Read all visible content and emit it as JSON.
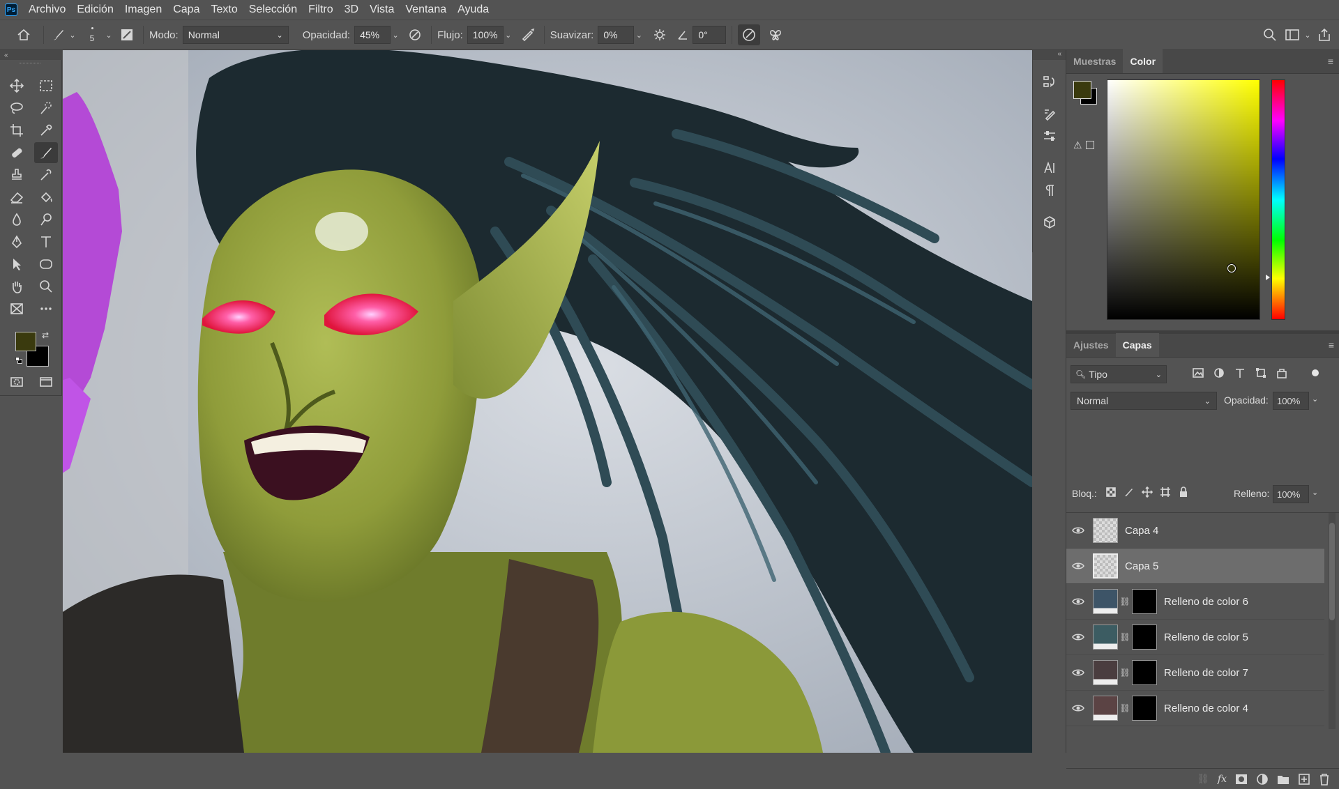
{
  "app": {
    "logo": "Ps"
  },
  "menu": [
    "Archivo",
    "Edición",
    "Imagen",
    "Capa",
    "Texto",
    "Selección",
    "Filtro",
    "3D",
    "Vista",
    "Ventana",
    "Ayuda"
  ],
  "options": {
    "brush_size": "5",
    "mode_label": "Modo:",
    "mode_value": "Normal",
    "opacity_label": "Opacidad:",
    "opacity_value": "45%",
    "flow_label": "Flujo:",
    "flow_value": "100%",
    "smooth_label": "Suavizar:",
    "smooth_value": "0%",
    "angle_value": "0°"
  },
  "colors": {
    "foreground": "#3a3a0e",
    "background": "#000000",
    "accent": "#31a8ff"
  },
  "color_panel": {
    "tabs": [
      "Muestras",
      "Color"
    ],
    "active_tab": "Color",
    "hue_hex": "#ffff00"
  },
  "layers_panel": {
    "tabs": [
      "Ajustes",
      "Capas"
    ],
    "active_tab": "Capas",
    "filter_value": "Tipo",
    "blend_mode": "Normal",
    "opacity_label": "Opacidad:",
    "opacity_value": "100%",
    "lock_label": "Bloq.:",
    "fill_label": "Relleno:",
    "fill_value": "100%",
    "layers": [
      {
        "name": "Capa 4",
        "kind": "pixel",
        "selected": false
      },
      {
        "name": "Capa 5",
        "kind": "pixel",
        "selected": true
      },
      {
        "name": "Relleno de color 6",
        "kind": "fill",
        "color": "#3d5467",
        "selected": false
      },
      {
        "name": "Relleno de color 5",
        "kind": "fill",
        "color": "#3c5c62",
        "selected": false
      },
      {
        "name": "Relleno de color 7",
        "kind": "fill",
        "color": "#4a3d3f",
        "selected": false
      },
      {
        "name": "Relleno de color 4",
        "kind": "fill",
        "color": "#5b4344",
        "selected": false
      }
    ]
  }
}
